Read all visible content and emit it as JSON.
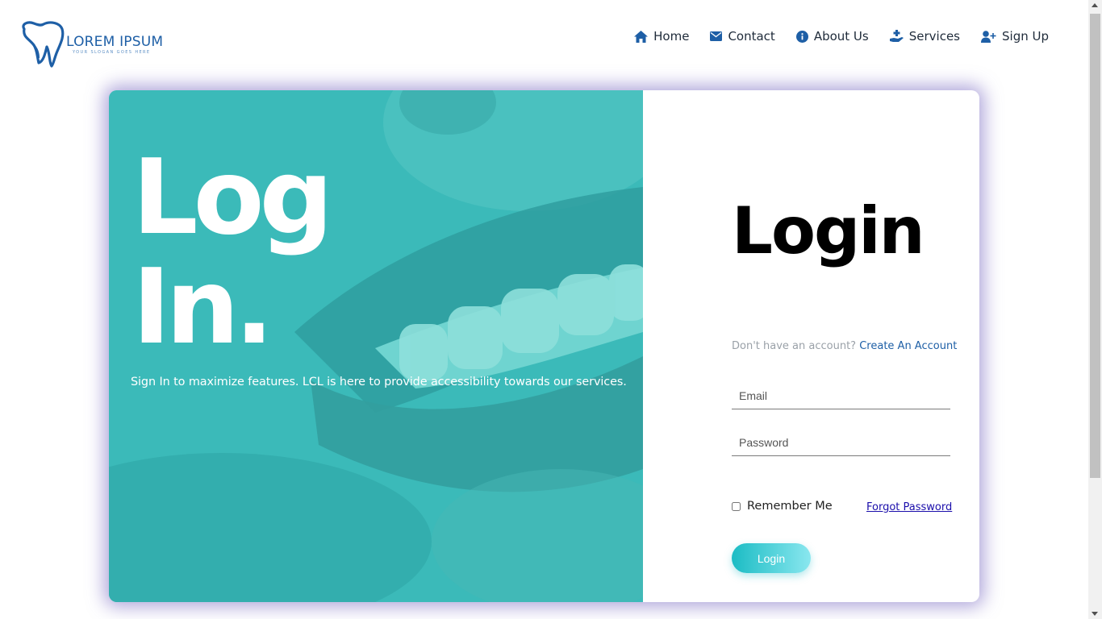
{
  "brand": {
    "name": "LOREM IPSUM",
    "slogan": "YOUR SLOGAN GOES HERE",
    "logo_icon": "tooth-icon",
    "color": "#1e5fa6"
  },
  "nav": {
    "items": [
      {
        "label": "Home",
        "icon": "home-icon"
      },
      {
        "label": "Contact",
        "icon": "envelope-icon"
      },
      {
        "label": "About Us",
        "icon": "info-circle-icon"
      },
      {
        "label": "Services",
        "icon": "hand-holding-medical-icon"
      },
      {
        "label": "Sign Up",
        "icon": "user-plus-icon"
      }
    ]
  },
  "hero": {
    "title_line1": "Log",
    "title_line2": "In.",
    "subtitle": "Sign In to maximize features. LCL is here to provide accessibility towards our services.",
    "background_color": "#3fbcbc"
  },
  "login_form": {
    "heading": "Login",
    "account_question": "Don't have an account?",
    "create_account_label": "Create An Account",
    "email_placeholder": "Email",
    "password_placeholder": "Password",
    "remember_label": "Remember Me",
    "remember_checked": false,
    "forgot_label": "Forgot Password",
    "submit_label": "Login"
  }
}
